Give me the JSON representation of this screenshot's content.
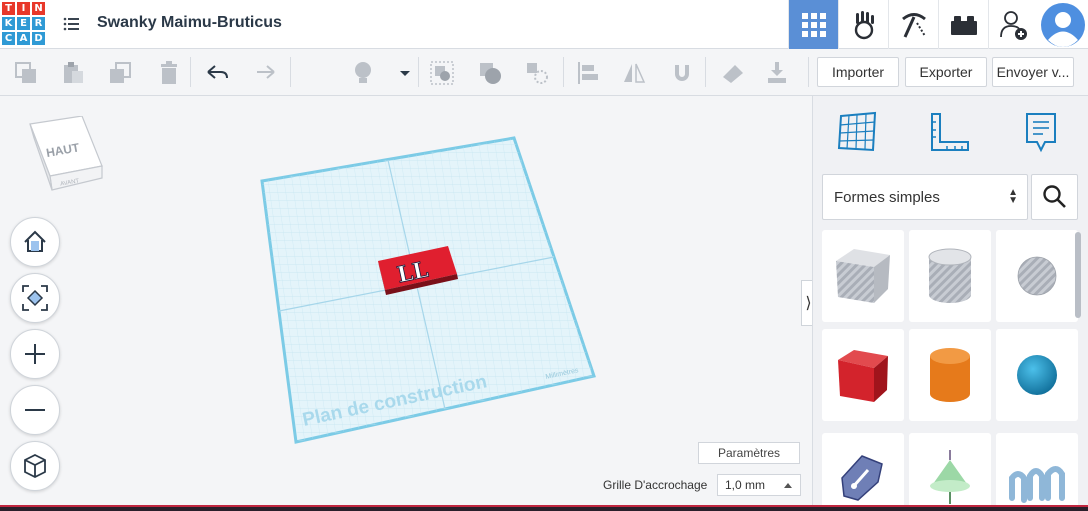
{
  "app": {
    "logo_letters": [
      "T",
      "I",
      "N",
      "K",
      "E",
      "R",
      "C",
      "A",
      "D"
    ],
    "logo_colors": [
      "#e8382a",
      "#e8382a",
      "#e8382a",
      "#2f9ad5",
      "#2f9ad5",
      "#2f9ad5",
      "#2f9ad5",
      "#2f9ad5",
      "#2f9ad5"
    ],
    "project_title": "Swanky Maimu-Bruticus"
  },
  "nav": {
    "items": [
      {
        "icon": "grid-3d-icon",
        "active": true
      },
      {
        "icon": "circuit-hand-icon",
        "active": false
      },
      {
        "icon": "pickaxe-icon",
        "active": false
      },
      {
        "icon": "brick-icon",
        "active": false
      },
      {
        "icon": "add-user-icon",
        "active": false
      },
      {
        "icon": "avatar-icon",
        "active": false
      }
    ]
  },
  "toolbar": {
    "import_label": "Importer",
    "export_label": "Exporter",
    "send_label": "Envoyer v..."
  },
  "viewcube": {
    "top_label": "HAUT",
    "front_label": "AVANT"
  },
  "workplane": {
    "label": "Plan de construction",
    "units_label": "Millimètres",
    "object_text": "LL",
    "object_color": "#e01f2f"
  },
  "settings": {
    "params_label": "Paramètres",
    "snap_label": "Grille D'accrochage",
    "snap_value": "1,0 mm"
  },
  "panel": {
    "shape_category": "Formes simples",
    "shapes": [
      {
        "name": "box-hole-shape"
      },
      {
        "name": "cylinder-hole-shape"
      },
      {
        "name": "sphere-hole-shape"
      },
      {
        "name": "box-shape",
        "color": "#d3232c"
      },
      {
        "name": "cylinder-shape",
        "color": "#e67a1b"
      },
      {
        "name": "sphere-shape",
        "color": "#1a8cc0"
      },
      {
        "name": "scribble-shape"
      },
      {
        "name": "roof-shape"
      },
      {
        "name": "text-shape"
      }
    ]
  },
  "colors": {
    "accent": "#5a8fd6",
    "grid": "#bfe3f0"
  }
}
